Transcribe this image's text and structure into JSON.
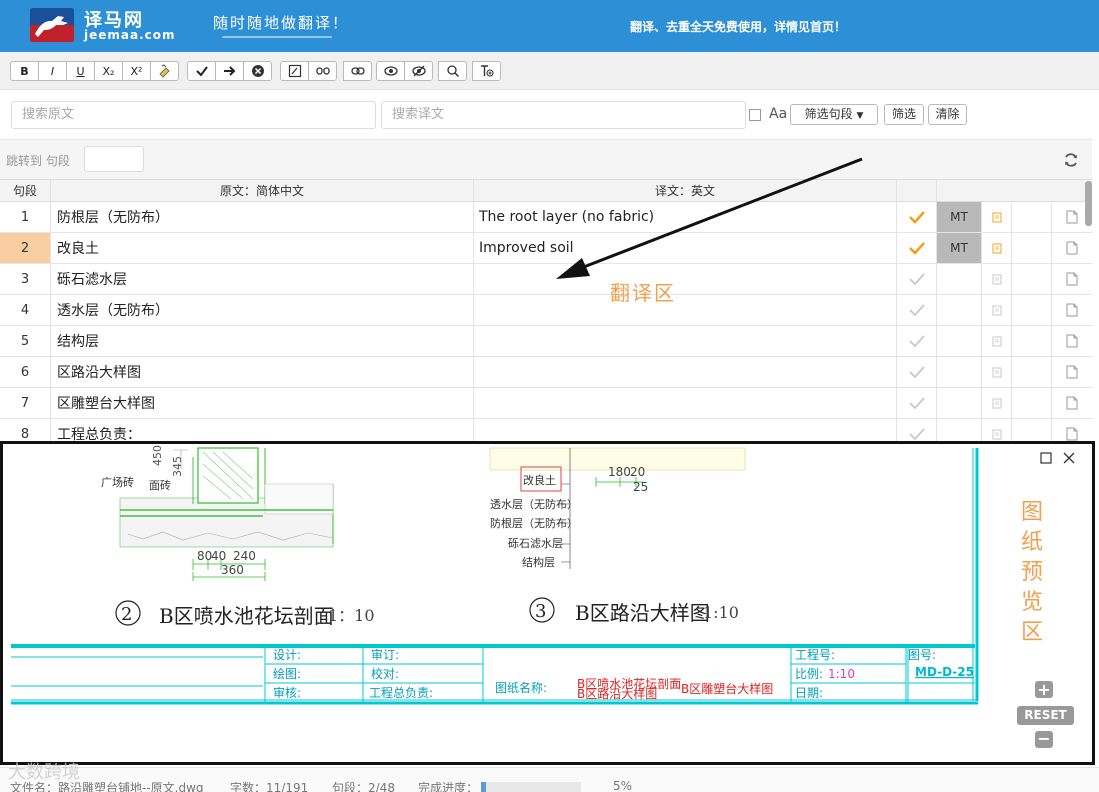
{
  "header": {
    "site_name": "译马网",
    "site_domain": "jeemaa.com",
    "slogan": "随时随地做翻译！",
    "notice": "翻译、去重全天免费使用，详情见首页！"
  },
  "toolbar": {
    "bold": "B",
    "italic": "I",
    "underline": "U",
    "subscript": "X₂",
    "superscript": "X²"
  },
  "search": {
    "source_placeholder": "搜索原文",
    "target_placeholder": "搜索译文",
    "case_label": "Aa",
    "filter_select": "筛选句段",
    "filter_button": "筛选",
    "clear_button": "清除"
  },
  "jump": {
    "label": "跳转到 句段"
  },
  "table": {
    "headers": {
      "num": "句段",
      "source": "原文：简体中文",
      "target": "译文：英文"
    },
    "rows": [
      {
        "num": "1",
        "source": "防根层（无防布）",
        "target": "The root layer (no fabric)",
        "confirmed": true,
        "mt": "MT"
      },
      {
        "num": "2",
        "source": "改良土",
        "target": "Improved soil",
        "confirmed": true,
        "mt": "MT"
      },
      {
        "num": "3",
        "source": "砾石滤水层",
        "target": "",
        "confirmed": false,
        "mt": ""
      },
      {
        "num": "4",
        "source": "透水层（无防布）",
        "target": "",
        "confirmed": false,
        "mt": ""
      },
      {
        "num": "5",
        "source": "结构层",
        "target": "",
        "confirmed": false,
        "mt": ""
      },
      {
        "num": "6",
        "source": "区路沿大样图",
        "target": "",
        "confirmed": false,
        "mt": ""
      },
      {
        "num": "7",
        "source": "区雕塑台大样图",
        "target": "",
        "confirmed": false,
        "mt": ""
      },
      {
        "num": "8",
        "source": "工程总负责：",
        "target": "",
        "confirmed": false,
        "mt": ""
      }
    ],
    "active_row": "2"
  },
  "annotation": {
    "translate_area": "翻译区"
  },
  "preview": {
    "side_label": "图纸预览区",
    "reset": "RESET",
    "plus": "+",
    "minus": "−",
    "drawing": {
      "dim_450": "450",
      "dim_345": "345",
      "plaza_brick": "广场砖",
      "edge_brick": "面砖",
      "dim_80": "80",
      "dim_40": "40",
      "dim_240": "240",
      "dim_360": "360",
      "dim_180": "180",
      "dim_20": "20",
      "dim_25": "25",
      "improved_soil": "改良土",
      "permeable": "透水层（无防布）",
      "root_layer": "防根层（无防布）",
      "gravel": "砾石滤水层",
      "structure": "结构层",
      "detail2_num": "2",
      "detail2_title": "B区喷水池花坛剖面",
      "detail2_scale": "1：10",
      "detail3_num": "3",
      "detail3_title": "B区路沿大样图",
      "detail3_scale": "1:10",
      "design": "设计:",
      "drawing_by": "绘图:",
      "review": "审核:",
      "approve": "审订:",
      "check": "校对:",
      "chief": "工程总负责:",
      "drawing_name": "图纸名称:",
      "name1": "B区喷水池花坛剖面",
      "name2": "B区路沿大样图",
      "name3": "B区雕塑台大样图",
      "project_no": "工程号:",
      "scale_label": "比例:",
      "scale_value": "1:10",
      "date": "日期:",
      "drawing_no_label": "图号:",
      "drawing_no": "MD-D-25"
    }
  },
  "status": {
    "filename": "文件名：路沿雕塑台铺地--原文.dwg",
    "wordcount": "字数：11/191",
    "segments": "句段：2/48",
    "progress_label": "完成进度：",
    "progress_percent": "5%",
    "progress_value": 0.05
  },
  "watermark": "大数跨境",
  "colors": {
    "header": "#2d8fd5",
    "accent": "#f0a050",
    "check": "#f0a020",
    "cad_line": "#00c8d0"
  }
}
